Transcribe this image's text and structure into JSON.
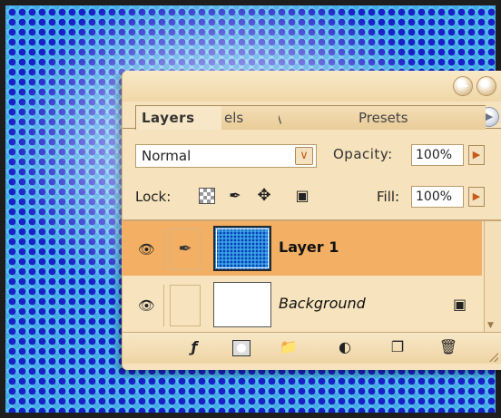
{
  "canvas": {
    "pattern": "blue halftone dots on cyan",
    "dot_color": "#1a20c8",
    "base_color": "#55c8ee"
  },
  "panel": {
    "accent_color": "#f3b064",
    "tabs": [
      {
        "label": "Layers",
        "active": true
      },
      {
        "label": "els",
        "active": false
      },
      {
        "label": "\\",
        "active": false
      },
      {
        "label": "\\",
        "active": false
      },
      {
        "label": "Presets",
        "active": false
      }
    ],
    "blend_mode": {
      "value": "Normal",
      "arrow_icon": "chevron-down-icon"
    },
    "opacity": {
      "label": "Opacity:",
      "value": "100%",
      "arrow_icon": "chevron-right-icon"
    },
    "lock": {
      "label": "Lock:",
      "icons": [
        "transparency-lock-icon",
        "brush-lock-icon",
        "move-lock-icon",
        "padlock-icon"
      ]
    },
    "fill": {
      "label": "Fill:",
      "value": "100%",
      "arrow_icon": "chevron-right-icon"
    },
    "layers": [
      {
        "name": "Layer 1",
        "selected": true,
        "visible": true,
        "brush_linked": true
      },
      {
        "name": "Background",
        "selected": false,
        "visible": true,
        "locked": true
      }
    ],
    "toolbar_icons": [
      "layer-style-icon",
      "layer-mask-icon",
      "folder-icon",
      "adjustment-layer-icon",
      "new-layer-icon",
      "trash-icon"
    ]
  }
}
